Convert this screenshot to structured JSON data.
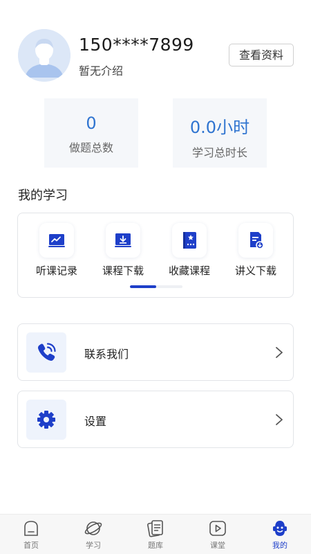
{
  "profile": {
    "phone": "150****7899",
    "intro": "暂无介绍",
    "view_profile_label": "查看资料"
  },
  "stats": [
    {
      "value": "0",
      "label": "做题总数"
    },
    {
      "value": "0.0小时",
      "label": "学习总时长"
    }
  ],
  "my_learning": {
    "title": "我的学习",
    "items": [
      {
        "label": "听课记录",
        "icon": "chart-monitor-icon"
      },
      {
        "label": "课程下载",
        "icon": "download-tray-icon"
      },
      {
        "label": "收藏课程",
        "icon": "bookmark-book-icon"
      },
      {
        "label": "讲义下载",
        "icon": "document-download-icon"
      }
    ],
    "page_indicator": {
      "current": 1,
      "total": 2
    }
  },
  "menu": [
    {
      "label": "联系我们",
      "icon": "phone-icon"
    },
    {
      "label": "设置",
      "icon": "gear-icon"
    }
  ],
  "tabbar": {
    "active": "我的",
    "items": [
      {
        "label": "首页",
        "icon": "home-icon"
      },
      {
        "label": "学习",
        "icon": "planet-icon"
      },
      {
        "label": "题库",
        "icon": "question-bank-icon"
      },
      {
        "label": "课堂",
        "icon": "play-icon"
      },
      {
        "label": "我的",
        "icon": "mine-face-icon"
      }
    ]
  },
  "colors": {
    "accent": "#1e3fc9",
    "stat_value": "#2f74d0",
    "icon_bg": "#eef3fc",
    "card_border": "#e2e4e8"
  }
}
